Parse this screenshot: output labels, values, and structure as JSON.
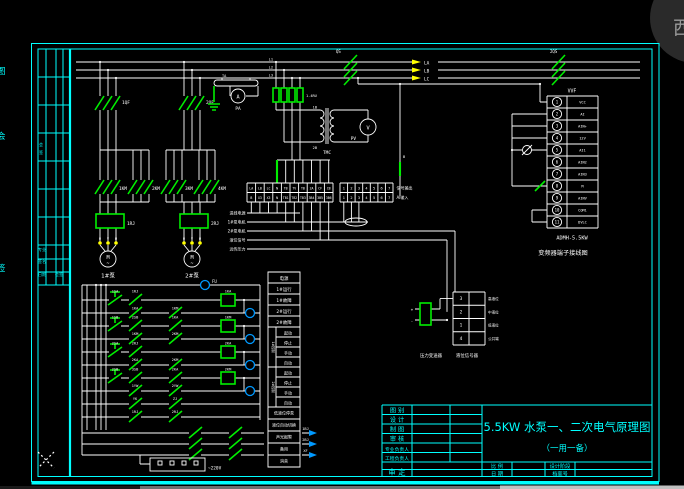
{
  "watermark": {
    "char": "西"
  },
  "edge": {
    "frag1": "图",
    "frag2": "会",
    "frag3": "签"
  },
  "revision": {
    "v1": "会",
    "v2": "签",
    "c1": "专业",
    "c2": "签名",
    "c3": "日期",
    "c4": "会签"
  },
  "titleblock": {
    "rows": [
      "图 别",
      "设 计",
      "制 图",
      "审 核",
      "专业负责人",
      "工程负责人"
    ],
    "approve": "审 定",
    "scale": "比 例",
    "date": "日 期",
    "stage": "设计阶段",
    "docno": "档案号",
    "title": "5.5KW 水泵一、二次电气原理图",
    "subtitle": "（一用一备）"
  },
  "power": {
    "qs1": "QS",
    "qs2": "2QS",
    "arrow_labels": [
      "LA",
      "LB",
      "LC"
    ],
    "tap_labels": [
      "L1",
      "L2",
      "L3"
    ],
    "qf": [
      "1QF",
      "2QF"
    ],
    "km": [
      "1KM",
      "2KM",
      "3KM",
      "4KM"
    ],
    "rj": [
      "1RJ",
      "2RJ"
    ],
    "ta": "TA",
    "a": "A",
    "pa": "PA",
    "ru": "1-4RU",
    "tmc": "TMC",
    "v": "V",
    "pv": "PV",
    "b": "B",
    "b1": "1B",
    "b2": "2B",
    "uvw": [
      "U",
      "V",
      "W"
    ],
    "m": "M",
    "tilde": "~",
    "motors": [
      "1#泵",
      "2#泵"
    ]
  },
  "vfd": {
    "title": "VVF",
    "numbers": [
      "1",
      "2",
      "3",
      "4",
      "5",
      "6",
      "7",
      "8",
      "9",
      "10",
      "11"
    ],
    "labels": [
      "VCC",
      "AI",
      "AIN+",
      "12V",
      "AI1",
      "AIN2",
      "AIN3",
      "M",
      "AINV",
      "COM1",
      "DVLC"
    ],
    "model": "ADMH-5.5KW",
    "caption": "变频器端子接线图"
  },
  "stripA": {
    "row1": [
      "LA",
      "LB",
      "LC",
      "N",
      "TB",
      "TV",
      "TB",
      "2A",
      "CF",
      "CB"
    ],
    "row2": [
      "B",
      "X3",
      "X3",
      "N",
      "TB1",
      "TB2",
      "TB3",
      "3B4",
      "3B5",
      "3B6"
    ]
  },
  "stripB": {
    "row1": [
      "1",
      "2",
      "3",
      "4",
      "5",
      "6",
      "7"
    ],
    "row2": [
      "1",
      "2",
      "3",
      "4",
      "5",
      "6",
      "7"
    ],
    "right_top": "信号输出",
    "right_bottom": "AI输入"
  },
  "cables": [
    "进线电源",
    "1#泵电机",
    "2#泵电机",
    "液位信号",
    "远传压力"
  ],
  "sensor": {
    "numbers": [
      "3",
      "2",
      "1",
      "4"
    ],
    "labels": [
      "高液位",
      "中液位",
      "低液位",
      "公共端"
    ],
    "plus": "+",
    "minus": "-",
    "cap1": "压力变送器",
    "cap2": "液位信号器"
  },
  "ladder": {
    "fu": "FU",
    "coils": [
      "1KA",
      "1KM",
      "2KA",
      "2KM"
    ],
    "r1": [
      "1SA",
      "1RJ"
    ],
    "r2": [
      "1KA",
      "1KM"
    ],
    "r3": [
      "1SB",
      "2SB",
      "1KA"
    ],
    "r4": [
      "1KM",
      "2KM"
    ],
    "r5": [
      "2SA",
      "2RJ"
    ],
    "r6": [
      "2KA",
      "2KM"
    ],
    "r7": [
      "2SB",
      "3SB",
      "2KA"
    ],
    "r8": [
      "1YW",
      "2YW"
    ],
    "r9": [
      "YK",
      "ZJ"
    ],
    "r10": [
      "1RJ",
      "2RJ"
    ],
    "bottom": [
      "1BJ",
      "2BJ",
      "XF"
    ],
    "socket": "~220V",
    "desc1": [
      "电源",
      "1#运行",
      "1#故障",
      "2#运行",
      "2#故障"
    ],
    "g1": "1#控制",
    "g2": "2#控制",
    "grows": [
      "起动",
      "停止",
      "手动",
      "自动"
    ],
    "desc2": [
      "低液位停泵",
      "液位自动切换",
      "声光报警",
      "备用",
      "消音"
    ]
  }
}
